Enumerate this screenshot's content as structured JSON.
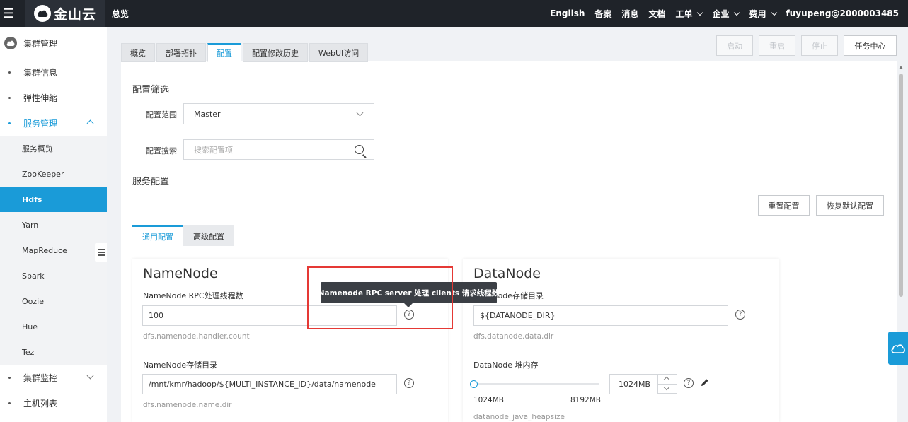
{
  "topbar": {
    "brand": "金山云",
    "title": "总览",
    "links": [
      "English",
      "备案",
      "消息",
      "文档"
    ],
    "menus": [
      "工单",
      "企业",
      "费用"
    ],
    "user": "fuyupeng@2000003485"
  },
  "sidebar": {
    "header": "集群管理",
    "items": [
      "集群信息",
      "弹性伸缩",
      "服务管理"
    ],
    "sub_items": [
      "服务概览",
      "ZooKeeper",
      "Hdfs",
      "Yarn",
      "MapReduce",
      "Spark",
      "Oozie",
      "Hue",
      "Tez"
    ],
    "bottom_items": [
      "集群监控",
      "主机列表"
    ],
    "active_sub": "Hdfs"
  },
  "tabs": [
    "概览",
    "部署拓扑",
    "配置",
    "配置修改历史",
    "WebUI访问"
  ],
  "active_tab": "配置",
  "actions": {
    "start": "启动",
    "restart": "重启",
    "stop": "停止",
    "task_center": "任务中心"
  },
  "filter": {
    "title": "配置筛选",
    "scope_label": "配置范围",
    "scope_value": "Master",
    "search_label": "配置搜索",
    "search_placeholder": "搜索配置项"
  },
  "service_config": {
    "title": "服务配置",
    "reset_btn": "重置配置",
    "restore_btn": "恢复默认配置",
    "subtabs": [
      "通用配置",
      "高级配置"
    ]
  },
  "namenode": {
    "title": "NameNode",
    "f1_label": "NameNode RPC处理线程数",
    "f1_value": "100",
    "f1_prop": "dfs.namenode.handler.count",
    "f2_label": "NameNode存储目录",
    "f2_value": "/mnt/kmr/hadoop/${MULTI_INSTANCE_ID}/data/namenode",
    "f2_prop": "dfs.namenode.name.dir"
  },
  "datanode": {
    "title": "DataNode",
    "f1_label": "DataNode存储目录",
    "f1_value": "${DATANODE_DIR}",
    "f1_prop": "dfs.datanode.data.dir",
    "f2_label": "DataNode 堆内存",
    "f2_value": "1024MB",
    "slider_min": "1024MB",
    "slider_max": "8192MB",
    "slider_level": 0,
    "f2_prop": "datanode_java_heapsize"
  },
  "tooltip": "Namenode RPC server 处理 clients 请求线程数",
  "help_glyph": "?",
  "colors": {
    "accent": "#1a9bd8",
    "topbar": "#1f2329",
    "highlight": "#e53935"
  }
}
